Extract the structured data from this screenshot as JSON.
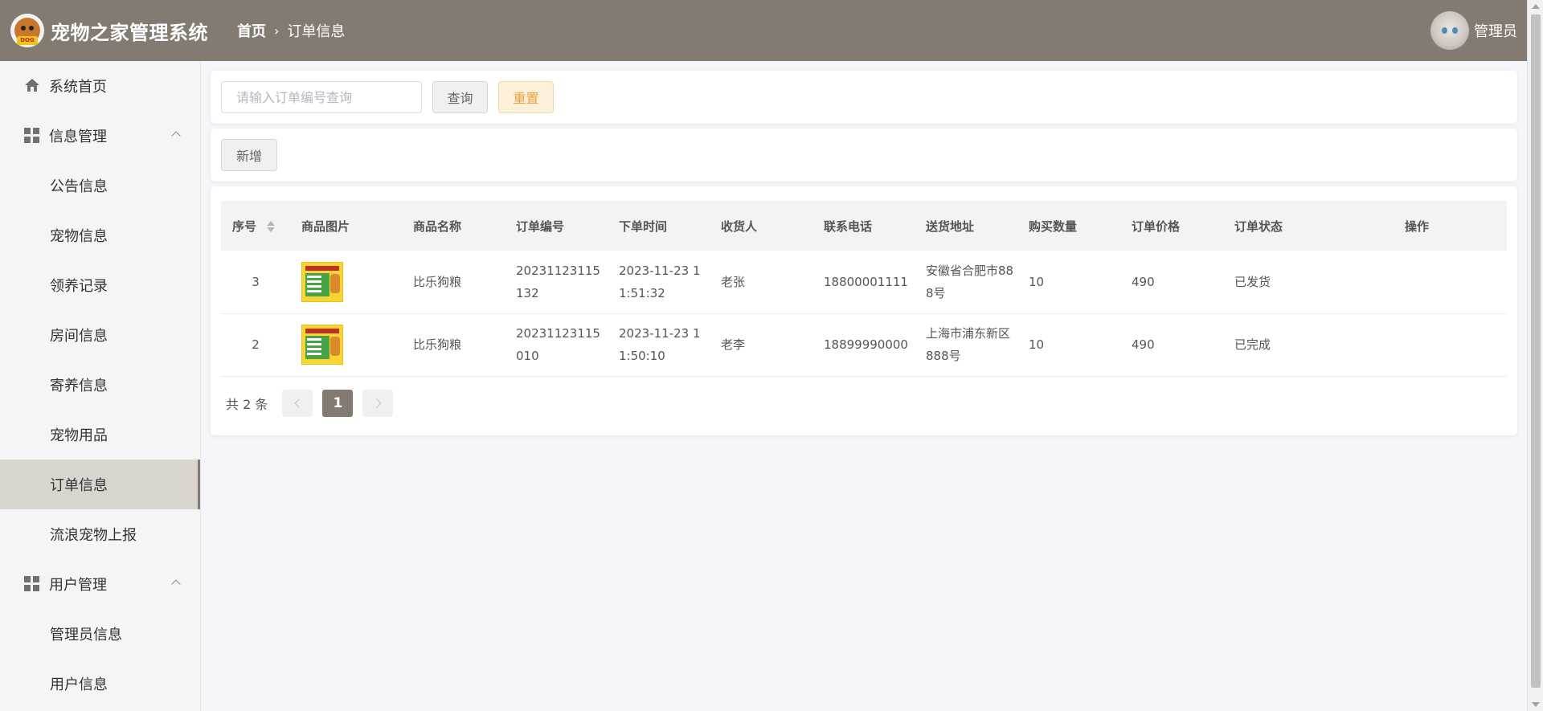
{
  "header": {
    "logo_text": "DOG",
    "app_title": "宠物之家管理系统",
    "breadcrumb": {
      "home": "首页",
      "current": "订单信息"
    },
    "user_name": "管理员"
  },
  "sidebar": {
    "items": [
      {
        "label": "系统首页",
        "type": "top",
        "icon": "home-icon"
      },
      {
        "label": "信息管理",
        "type": "top",
        "icon": "grid-icon",
        "expanded": true
      },
      {
        "label": "公告信息",
        "type": "sub"
      },
      {
        "label": "宠物信息",
        "type": "sub"
      },
      {
        "label": "领养记录",
        "type": "sub"
      },
      {
        "label": "房间信息",
        "type": "sub"
      },
      {
        "label": "寄养信息",
        "type": "sub"
      },
      {
        "label": "宠物用品",
        "type": "sub"
      },
      {
        "label": "订单信息",
        "type": "sub",
        "active": true
      },
      {
        "label": "流浪宠物上报",
        "type": "sub"
      },
      {
        "label": "用户管理",
        "type": "top",
        "icon": "grid-icon",
        "expanded": true
      },
      {
        "label": "管理员信息",
        "type": "sub"
      },
      {
        "label": "用户信息",
        "type": "sub"
      }
    ]
  },
  "search": {
    "placeholder": "请输入订单编号查询",
    "value": "",
    "query_label": "查询",
    "reset_label": "重置"
  },
  "toolbar": {
    "add_label": "新增"
  },
  "table": {
    "columns": [
      "序号",
      "商品图片",
      "商品名称",
      "订单编号",
      "下单时间",
      "收货人",
      "联系电话",
      "送货地址",
      "购买数量",
      "订单价格",
      "订单状态",
      "操作"
    ],
    "rows": [
      {
        "index": "3",
        "product": "比乐狗粮",
        "order_no": "20231123115132",
        "time": "2023-11-23 11:51:32",
        "consignee": "老张",
        "phone": "18800001111",
        "address": "安徽省合肥市888号",
        "qty": "10",
        "price": "490",
        "status": "已发货",
        "action": ""
      },
      {
        "index": "2",
        "product": "比乐狗粮",
        "order_no": "20231123115010",
        "time": "2023-11-23 11:50:10",
        "consignee": "老李",
        "phone": "18899990000",
        "address": "上海市浦东新区888号",
        "qty": "10",
        "price": "490",
        "status": "已完成",
        "action": ""
      }
    ]
  },
  "pagination": {
    "total_label": "共 2 条",
    "current_page": "1"
  },
  "colors": {
    "header_bg": "#837b71",
    "active_menu_bg": "#d8d4ce",
    "reset_text": "#e6a23c"
  }
}
